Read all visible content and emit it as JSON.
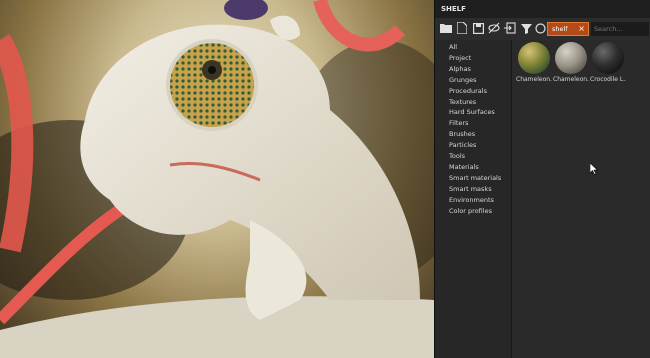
{
  "panel": {
    "title": "SHELF"
  },
  "toolbar": {
    "filter_tag": "shelf",
    "search_placeholder": "Search..."
  },
  "icons": [
    "folder-icon",
    "new-file-icon",
    "save-icon",
    "hide-icon",
    "import-icon",
    "filter-icon",
    "circle-icon",
    "close-icon"
  ],
  "categories": [
    "All",
    "Project",
    "Alphas",
    "Grunges",
    "Procedurals",
    "Textures",
    "Hard Surfaces",
    "Filters",
    "Brushes",
    "Particles",
    "Tools",
    "Materials",
    "Smart materials",
    "Smart masks",
    "Environments",
    "Color profiles"
  ],
  "resources": [
    {
      "label": "Chameleon...",
      "material": "woven-green"
    },
    {
      "label": "Chameleon...",
      "material": "stone-grey"
    },
    {
      "label": "Crocodile L...",
      "material": "dark-leather"
    }
  ],
  "colors": {
    "panel_bg": "#262626",
    "accent": "#b34a17",
    "text": "#d8d8d8"
  }
}
